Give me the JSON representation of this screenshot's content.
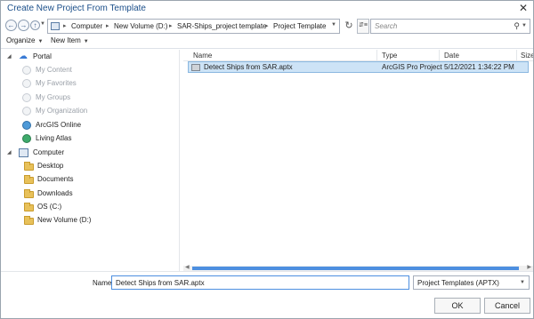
{
  "window": {
    "title": "Create New Project From Template",
    "close_glyph": "✕"
  },
  "address": {
    "crumbs": [
      "Computer",
      "New Volume (D:)",
      "SAR-Ships_project template",
      "Project Template"
    ],
    "search_placeholder": "Search"
  },
  "toolbar": {
    "organize_label": "Organize",
    "new_item_label": "New Item"
  },
  "nav": {
    "portal_label": "Portal",
    "portal_items": [
      "My Content",
      "My Favorites",
      "My Groups",
      "My Organization",
      "ArcGIS Online",
      "Living Atlas"
    ],
    "computer_label": "Computer",
    "computer_items": [
      "Desktop",
      "Documents",
      "Downloads",
      "OS (C:)",
      "New Volume (D:)"
    ]
  },
  "files": {
    "columns": [
      "Name",
      "Type",
      "Date",
      "Size"
    ],
    "rows": [
      {
        "name": "Detect Ships from SAR.aptx",
        "type": "ArcGIS Pro Project",
        "date": "5/12/2021 1:34:22 PM"
      }
    ]
  },
  "footer": {
    "name_label": "Name",
    "name_value": "Detect Ships from SAR.aptx",
    "filetype_value": "Project Templates (APTX)",
    "ok_label": "OK",
    "cancel_label": "Cancel"
  },
  "colors": {
    "accent": "#4d8fe0",
    "selection": "#cde3f6",
    "title": "#1b4f8a"
  }
}
